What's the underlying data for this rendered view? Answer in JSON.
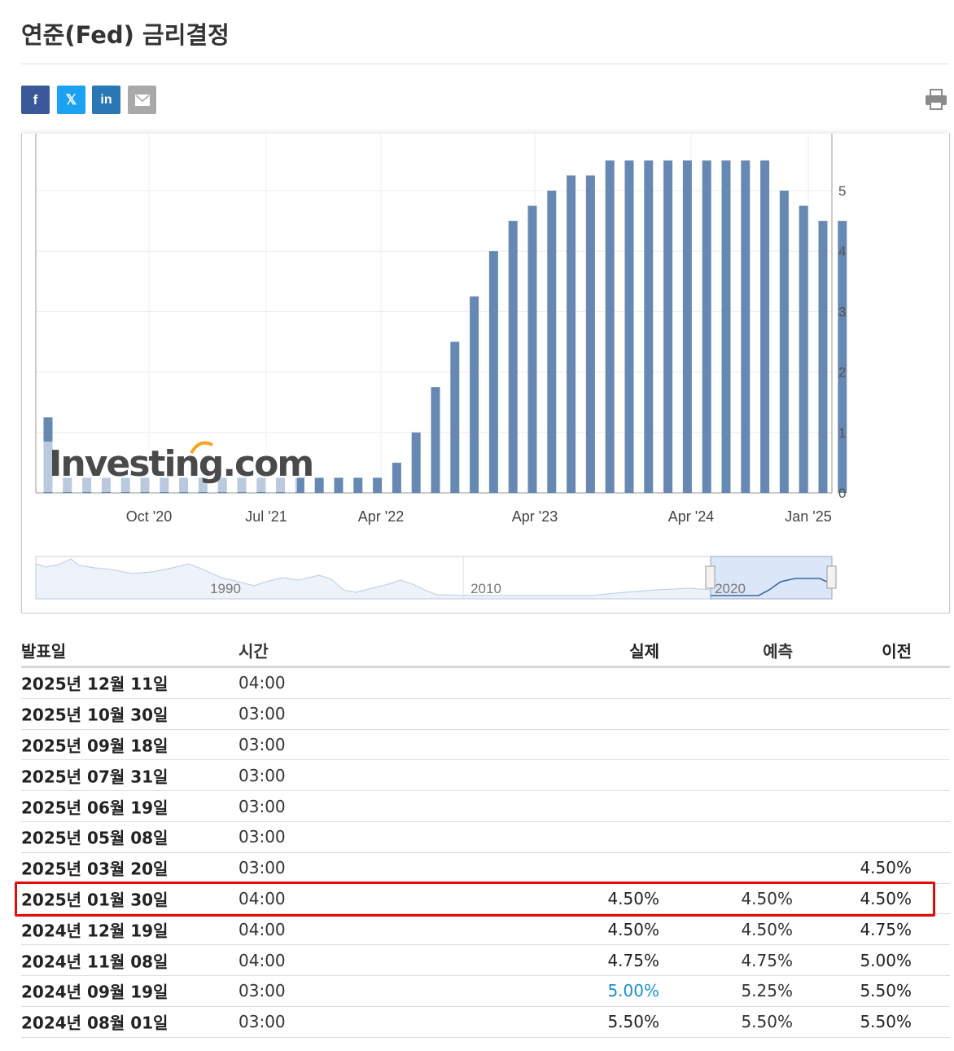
{
  "page_title": "연준(Fed) 금리결정",
  "share": {
    "facebook_icon": "f",
    "twitter_icon": "𝕏",
    "linkedin_icon": "in",
    "email_icon": "email-icon",
    "print_icon": "print-icon"
  },
  "chart_data": {
    "type": "bar",
    "series": [
      {
        "values": [
          1.25,
          0.25,
          0.25,
          0.25,
          0.25,
          0.25,
          0.25,
          0.25,
          0.25,
          0.25,
          0.25,
          0.25,
          0.25,
          0.25,
          0.25,
          0.25,
          0.25,
          0.25,
          0.5,
          1.0,
          1.75,
          2.5,
          3.25,
          4.0,
          4.5,
          4.75,
          5.0,
          5.25,
          5.25,
          5.5,
          5.5,
          5.5,
          5.5,
          5.5,
          5.5,
          5.5,
          5.5,
          5.5,
          5.0,
          4.75,
          4.5,
          4.5
        ]
      }
    ],
    "x_tick_labels": [
      "Oct '20",
      "Jul '21",
      "Apr '22",
      "Apr '23",
      "Apr '24",
      "Jan '25"
    ],
    "y_tick_labels": [
      "0",
      "1",
      "2",
      "3",
      "4",
      "5"
    ],
    "ylim": [
      0,
      6
    ],
    "y_axis_position": "right",
    "grid": true,
    "bar_color": "#6688b3",
    "watermark": "Investing.com",
    "navigator": {
      "labels": [
        "1990",
        "2010",
        "2020"
      ]
    }
  },
  "table": {
    "headers": {
      "date": "발표일",
      "time": "시간",
      "actual": "실제",
      "forecast": "예측",
      "previous": "이전"
    },
    "rows": [
      {
        "date": "2025년 12월 11일",
        "time": "04:00",
        "actual": "",
        "forecast": "",
        "previous": ""
      },
      {
        "date": "2025년 10월 30일",
        "time": "03:00",
        "actual": "",
        "forecast": "",
        "previous": ""
      },
      {
        "date": "2025년 09월 18일",
        "time": "03:00",
        "actual": "",
        "forecast": "",
        "previous": ""
      },
      {
        "date": "2025년 07월 31일",
        "time": "03:00",
        "actual": "",
        "forecast": "",
        "previous": ""
      },
      {
        "date": "2025년 06월 19일",
        "time": "03:00",
        "actual": "",
        "forecast": "",
        "previous": ""
      },
      {
        "date": "2025년 05월 08일",
        "time": "03:00",
        "actual": "",
        "forecast": "",
        "previous": ""
      },
      {
        "date": "2025년 03월 20일",
        "time": "03:00",
        "actual": "",
        "forecast": "",
        "previous": "4.50%"
      },
      {
        "date": "2025년 01월 30일",
        "time": "04:00",
        "actual": "4.50%",
        "forecast": "4.50%",
        "previous": "4.50%"
      },
      {
        "date": "2024년 12월 19일",
        "time": "04:00",
        "actual": "4.50%",
        "forecast": "4.50%",
        "previous": "4.75%"
      },
      {
        "date": "2024년 11월 08일",
        "time": "04:00",
        "actual": "4.75%",
        "forecast": "4.75%",
        "previous": "5.00%"
      },
      {
        "date": "2024년 09월 19일",
        "time": "03:00",
        "actual": "5.00%",
        "forecast": "5.25%",
        "previous": "5.50%",
        "actual_color": "#1a8fd6"
      },
      {
        "date": "2024년 08월 01일",
        "time": "03:00",
        "actual": "5.50%",
        "forecast": "5.50%",
        "previous": "5.50%"
      }
    ],
    "highlight_color": "#e20a0a"
  }
}
